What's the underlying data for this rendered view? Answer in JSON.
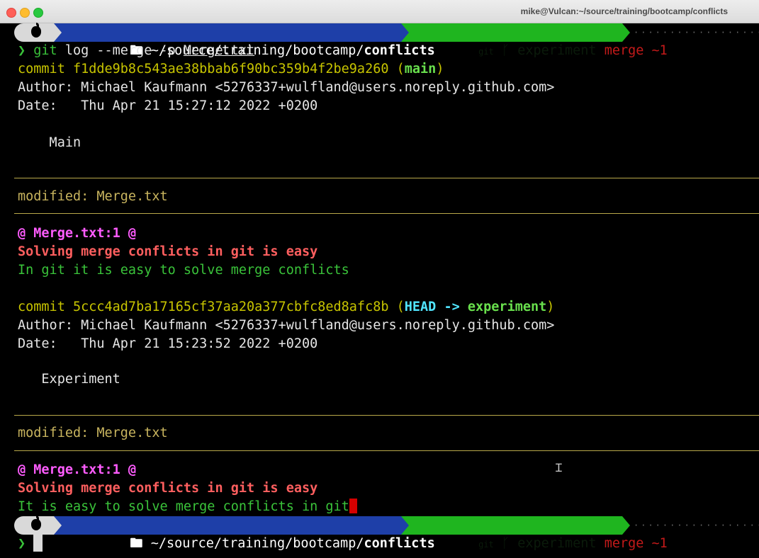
{
  "window": {
    "title": "mike@Vulcan:~/source/training/bootcamp/conflicts"
  },
  "prompt": {
    "path_prefix": "~/source/training/bootcamp/",
    "path_dir": "conflicts",
    "git_label": "git",
    "branch_icon": "branch-icon",
    "branch": "experiment",
    "state": "merge ~1",
    "dots": "·····················"
  },
  "command": {
    "chevron": "❯",
    "cmd": "git",
    "args": " log --merge -p ",
    "file": "Merge.txt"
  },
  "commits": [
    {
      "hash_label": "commit f1dde9b8c543ae38bbab6f90bc359b4f2be9a260 (",
      "refs": "main",
      "close": ")",
      "author": "Author: Michael Kaufmann <5276337+wulfland@users.noreply.github.com>",
      "date": "Date:   Thu Apr 21 15:27:12 2022 +0200",
      "message": "    Main",
      "modified": "modified: Merge.txt",
      "hunk": "@ Merge.txt:1 @",
      "removed": "Solving merge conflicts in git is easy",
      "added": "In git it is easy to solve merge conflicts"
    },
    {
      "hash_label": "commit 5ccc4ad7ba17165cf37aa20a377cbfc8ed8afc8b (",
      "refs_head": "HEAD -> ",
      "refs": "experiment",
      "close": ")",
      "author": "Author: Michael Kaufmann <5276337+wulfland@users.noreply.github.com>",
      "date": "Date:   Thu Apr 21 15:23:52 2022 +0200",
      "message": "   Experiment",
      "modified": "modified: Merge.txt",
      "hunk": "@ Merge.txt:1 @",
      "removed": "Solving merge conflicts in git is easy",
      "added": "It is easy to solve merge conflicts in git"
    }
  ],
  "colors": {
    "terminal_bg": "#000000",
    "path_segment": "#1e3fa8",
    "git_segment": "#1fb51f",
    "diff_removed": "#ff5f5f",
    "diff_added": "#3ac33a"
  }
}
